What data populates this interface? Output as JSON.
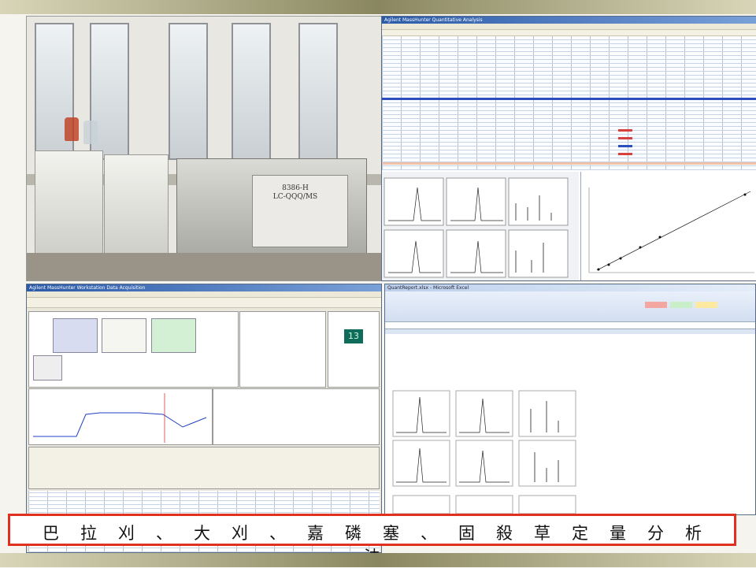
{
  "photo": {
    "instrument_label": "8386-H\nLC-QQQ/MS"
  },
  "quant": {
    "title": "Agilent MassHunter Quantitative Analysis"
  },
  "acq": {
    "title": "Agilent MassHunter Workstation Data Acquisition",
    "lcd_value": "13"
  },
  "excel": {
    "title": "QuantReport.xlsx - Microsoft Excel"
  },
  "caption": {
    "text": "巴拉刈、大刈、嘉磷塞、固殺草定量分析法"
  }
}
